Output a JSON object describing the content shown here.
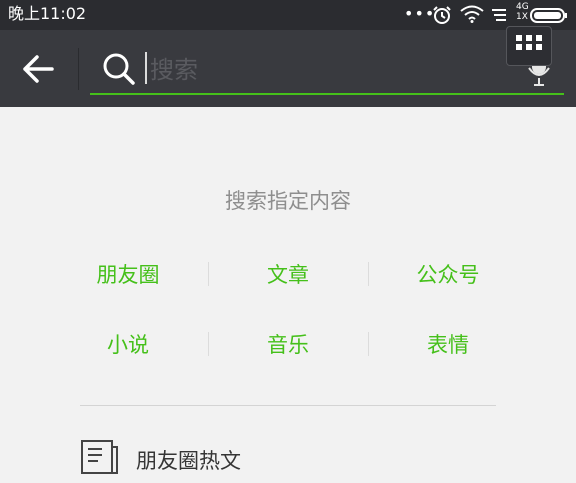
{
  "status_bar": {
    "time": "晚上11:02",
    "dots": "•••",
    "network": "4G\n1X"
  },
  "header": {
    "search_placeholder": "搜索"
  },
  "content": {
    "hint": "搜索指定内容",
    "categories": [
      "朋友圈",
      "文章",
      "公众号",
      "小说",
      "音乐",
      "表情"
    ],
    "hot_article_label": "朋友圈热文"
  },
  "colors": {
    "accent": "#45c01a",
    "appbar": "#393a3f",
    "statusbar": "#2b2c30",
    "background": "#f2f2f2"
  }
}
